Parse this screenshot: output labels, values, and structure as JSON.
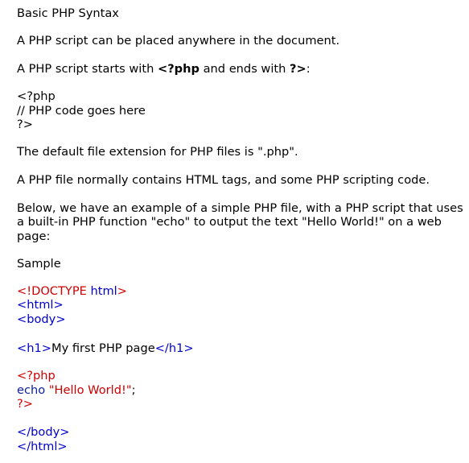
{
  "doc": {
    "title": "Basic PHP Syntax",
    "p1": "A PHP script can be placed anywhere in the document.",
    "p2": {
      "a": "A PHP script starts with ",
      "open_tag": "<?php",
      "b": " and ends with ",
      "close_tag": "?>",
      "c": ":"
    },
    "syntax_code": [
      "<?php",
      "// PHP code goes here",
      "?>"
    ],
    "p3": "The default file extension for PHP files is \".php\".",
    "p4": "A PHP file normally contains HTML tags, and some PHP scripting code.",
    "p5_lines": [
      "Below, we have an example of a simple PHP file, with a PHP script that uses",
      "a built-in PHP function \"echo\" to output the text \"Hello World!\" on a web",
      "page:"
    ],
    "sample_label": "Sample",
    "sample": {
      "doctype_open": "<!DOCTYPE ",
      "doctype_html": "html",
      "doctype_close": ">",
      "html_open": "<html>",
      "body_open": "<body>",
      "h1_open": "<h1>",
      "h1_text": "My first PHP page",
      "h1_close": "</h1>",
      "php_open": "<?php",
      "echo_kw": "echo ",
      "echo_str": "\"Hello World!\"",
      "echo_semi": ";",
      "php_close": "?>",
      "body_close": "</body>",
      "html_close": "</html>"
    }
  }
}
